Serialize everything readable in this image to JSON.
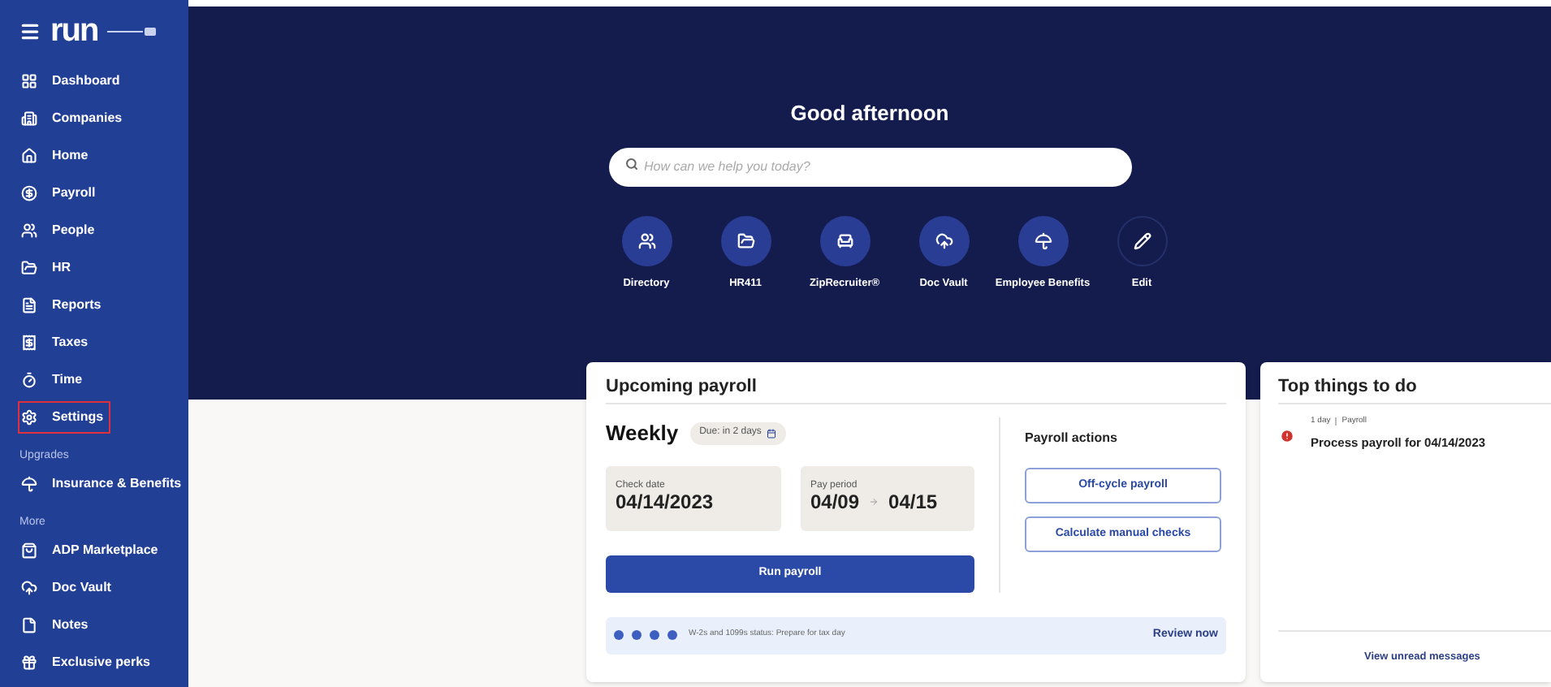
{
  "sidebar": {
    "logo": "run",
    "items": [
      {
        "kind": "item",
        "label": "Dashboard",
        "highlighted": false
      },
      {
        "kind": "item",
        "label": "Companies",
        "highlighted": false
      },
      {
        "kind": "item",
        "label": "Home",
        "highlighted": false
      },
      {
        "kind": "item",
        "label": "Payroll",
        "highlighted": false
      },
      {
        "kind": "item",
        "label": "People",
        "highlighted": false
      },
      {
        "kind": "item",
        "label": "HR",
        "highlighted": false
      },
      {
        "kind": "item",
        "label": "Reports",
        "highlighted": false
      },
      {
        "kind": "item",
        "label": "Taxes",
        "highlighted": false
      },
      {
        "kind": "item",
        "label": "Time",
        "highlighted": false
      },
      {
        "kind": "item",
        "label": "Settings",
        "highlighted": true
      },
      {
        "kind": "section",
        "label": "Upgrades"
      },
      {
        "kind": "item",
        "label": "Insurance & Benefits",
        "highlighted": false
      },
      {
        "kind": "section",
        "label": "More"
      },
      {
        "kind": "item",
        "label": "ADP Marketplace",
        "highlighted": false
      },
      {
        "kind": "item",
        "label": "Doc Vault",
        "highlighted": false
      },
      {
        "kind": "item",
        "label": "Notes",
        "highlighted": false
      },
      {
        "kind": "item",
        "label": "Exclusive perks",
        "highlighted": false
      }
    ]
  },
  "greeting": "Good afternoon",
  "search": {
    "placeholder": "How can we help you today?"
  },
  "shortcuts": [
    {
      "label": "Directory",
      "filled": true
    },
    {
      "label": "HR411",
      "filled": true
    },
    {
      "label": "ZipRecruiter®",
      "filled": true
    },
    {
      "label": "Doc Vault",
      "filled": true
    },
    {
      "label": "Employee Benefits",
      "filled": true
    },
    {
      "label": "Edit",
      "filled": false
    }
  ],
  "upcoming_payroll": {
    "title": "Upcoming payroll",
    "frequency": "Weekly",
    "due": "Due: in 2 days",
    "check_date_label": "Check date",
    "check_date": "04/14/2023",
    "pay_period_label": "Pay period",
    "pay_period_start": "04/09",
    "pay_period_end": "04/15",
    "run_button": "Run payroll",
    "actions_title": "Payroll actions",
    "actions": [
      "Off-cycle payroll",
      "Calculate manual checks"
    ],
    "notice": "W-2s and 1099s status: Prepare for tax day",
    "notice_link": "Review now"
  },
  "top_things": {
    "title": "Top things to do",
    "items": [
      {
        "age": "1 day",
        "category": "Payroll",
        "text": "Process payroll for 04/14/2023"
      }
    ],
    "footer_link": "View unread messages"
  }
}
